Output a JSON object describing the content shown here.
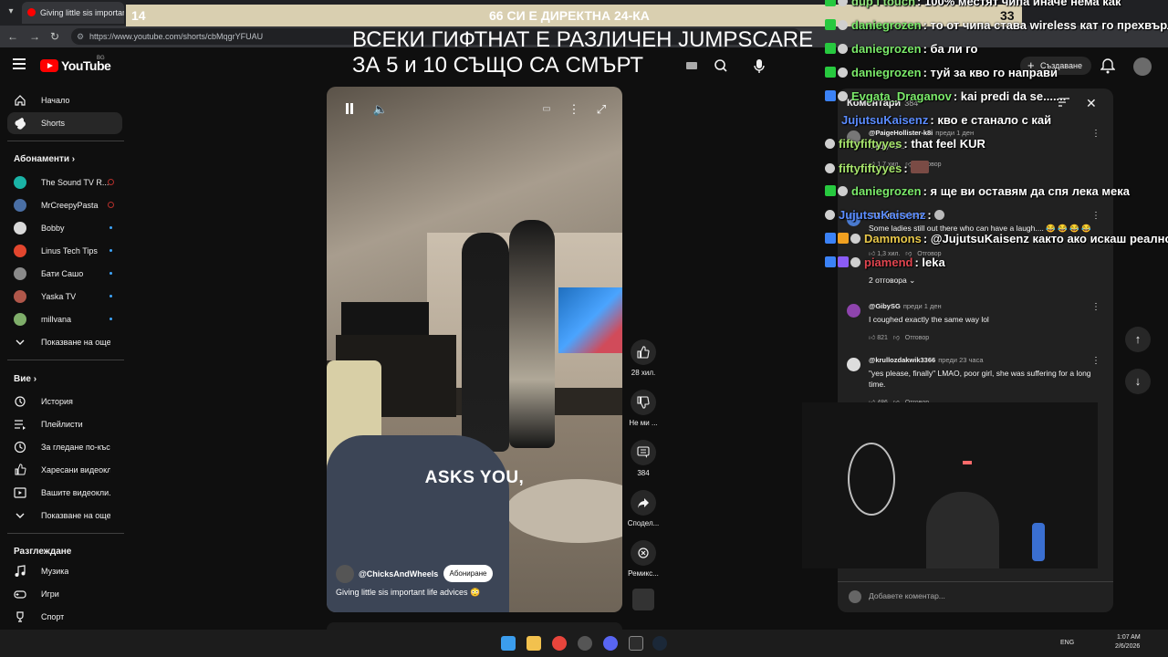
{
  "browser": {
    "tab_title": "Giving little sis important l",
    "url": "https://www.youtube.com/shorts/cbMqgrYFUAU"
  },
  "overlay": {
    "left_num": "14",
    "center_text": "66 СИ Е ДИРЕКТНА 24-КА",
    "right_num": "33",
    "jumpscare_line1": "ВСЕКИ ГИФТНАТ Е РАЗЛИЧЕН JUMPSCARE",
    "jumpscare_line2": "ЗА 5 и 10 СЪЩО СА СМЪРТ"
  },
  "youtube": {
    "logo_text": "YouTube",
    "country": "BG",
    "create_label": "Създаване"
  },
  "sidebar": {
    "items": [
      {
        "label": "Начало",
        "icon": "home-icon"
      },
      {
        "label": "Shorts",
        "icon": "shorts-icon"
      }
    ],
    "subs_header": "Абонаменти",
    "subscriptions": [
      {
        "label": "The Sound TV R...",
        "color": "#1ab3a6",
        "status": "live"
      },
      {
        "label": "MrCreepyPasta",
        "color": "#4a6fa5",
        "status": "live"
      },
      {
        "label": "Bobby",
        "color": "#d9d9d9",
        "status": "new"
      },
      {
        "label": "Linus Tech Tips",
        "color": "#e2462e",
        "status": "new"
      },
      {
        "label": "Бати Сашо",
        "color": "#8a8a8a",
        "status": "new"
      },
      {
        "label": "Yaska TV",
        "color": "#b0574a",
        "status": "new"
      },
      {
        "label": "millvana",
        "color": "#7fae6a",
        "status": "new"
      }
    ],
    "show_more": "Показване на още",
    "you_header": "Вие",
    "you_items": [
      {
        "label": "История",
        "icon": "history-icon"
      },
      {
        "label": "Плейлисти",
        "icon": "playlist-icon"
      },
      {
        "label": "За гледане по-къс...",
        "icon": "watch-later-icon"
      },
      {
        "label": "Харесани видеокл...",
        "icon": "like-icon"
      },
      {
        "label": "Вашите видеокли...",
        "icon": "your-videos-icon"
      },
      {
        "label": "Показване на още",
        "icon": "chevron-down-icon"
      }
    ],
    "explore_header": "Разглеждане",
    "explore_items": [
      {
        "label": "Музика",
        "icon": "music-icon"
      },
      {
        "label": "Игри",
        "icon": "gaming-icon"
      },
      {
        "label": "Спорт",
        "icon": "trophy-icon"
      }
    ]
  },
  "video": {
    "caption": "ASKS YOU,",
    "channel": "@ChicksAndWheels",
    "subscribe": "Абониране",
    "title": "Giving little sis important life advices 😳"
  },
  "actions": {
    "likes": "28 хил.",
    "dislike": "Не ми ...",
    "comments": "384",
    "share": "Сподел...",
    "remix": "Ремикс..."
  },
  "comments": {
    "header": "Коментари",
    "count": "384",
    "items": [
      {
        "user": "@PaigeHollister-k8i",
        "time": "преди 1 ден",
        "text": "...edly fun.",
        "likes": "1,7 хил.",
        "reply": "Отговор",
        "color": "#777777"
      },
      {
        "user": "@JujutsuKaisenz",
        "time": "",
        "text": "Some ladies still out there who can have a laugh.... 😂 😂 😂 😂",
        "likes": "1,3 хил.",
        "reply": "Отговор",
        "color": "#4a7bd1"
      },
      {
        "user": "@GibySG",
        "time": "преди 1 ден",
        "text": "I coughed exactly the same way lol",
        "likes": "821",
        "reply": "Отговор",
        "color": "#8e44ad"
      },
      {
        "user": "@krullozdakwik3366",
        "time": "преди 23 часа",
        "text": "\"yes please, finally\" LMAO, poor girl, she was suffering for a long time.",
        "likes": "486",
        "reply": "Отговор",
        "color": "#dddddd"
      }
    ],
    "replies": "2 отговора",
    "add_placeholder": "Добавете коментар..."
  },
  "chat": [
    {
      "user": "dup i touch",
      "msg": "100% местят чипа иначе нема как",
      "color": "#8fe37a",
      "badge": "#27c93f"
    },
    {
      "user": "daniegrozen",
      "msg": "то от чипа става wireless кат го прехвърлиш",
      "color": "#7bea6a",
      "badge": "#27c93f"
    },
    {
      "user": "daniegrozen",
      "msg": "ба ли го",
      "color": "#7bea6a",
      "badge": "#27c93f"
    },
    {
      "user": "daniegrozen",
      "msg": "туй за кво го направи",
      "color": "#7bea6a",
      "badge": "#27c93f"
    },
    {
      "user": "Evgata_Draganov",
      "msg": "kai predi da se.......",
      "color": "#7bea6a",
      "badge": "#3b82f6"
    },
    {
      "user": "JujutsuKaisenz",
      "msg": "кво е станало с кай",
      "color": "#5b8cff",
      "badge": ""
    },
    {
      "user": "fiftyfiftyyes",
      "msg": "that feel KUR",
      "color": "#a6e36b",
      "badge": ""
    },
    {
      "user": "fiftyfiftyyes",
      "msg": "",
      "color": "#a6e36b",
      "badge": ""
    },
    {
      "user": "daniegrozen",
      "msg": "я ще ви оставям да спя лека мека",
      "color": "#7bea6a",
      "badge": "#27c93f"
    },
    {
      "user": "JujutsuKaisenz",
      "msg": "",
      "color": "#5b8cff",
      "badge": ""
    },
    {
      "user": "Dammons",
      "msg": "@JujutsuKaisenz както ако искаш реално",
      "color": "#e8c84a",
      "badge": "#3b82f6"
    },
    {
      "user": "piamend",
      "msg": "leka",
      "color": "#e0454f",
      "badge": "#3b82f6"
    }
  ],
  "taskbar": {
    "lang": "ENG",
    "time": "1:07 AM",
    "date": "2/6/2026"
  }
}
